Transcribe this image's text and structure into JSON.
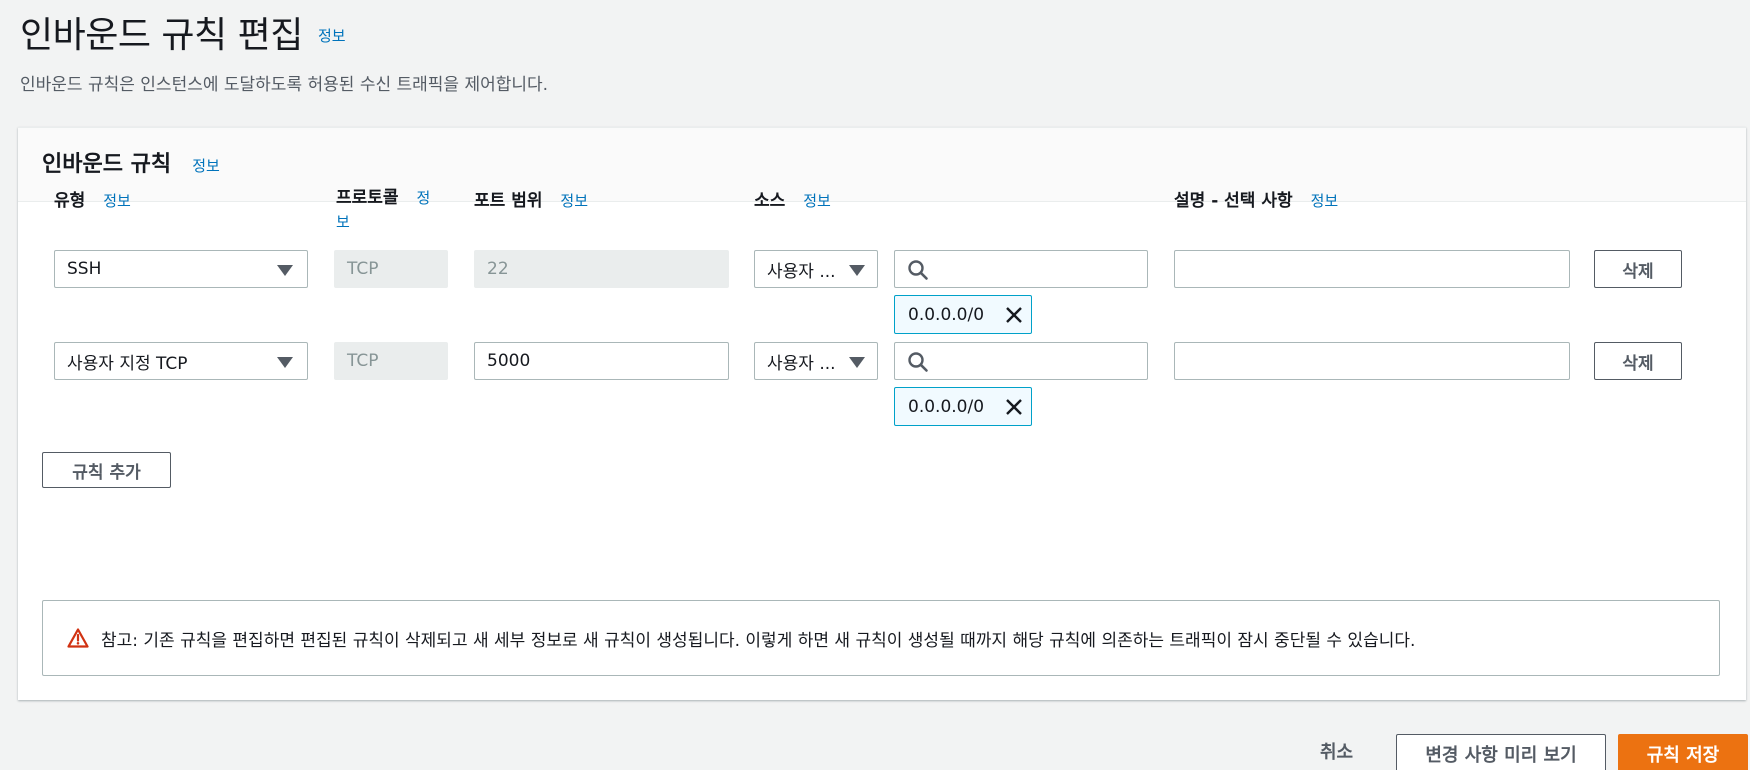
{
  "page": {
    "title": "인바운드 규칙 편집",
    "info": "정보",
    "description": "인바운드 규칙은 인스턴스에 도달하도록 허용된 수신 트래픽을 제어합니다."
  },
  "panel": {
    "title": "인바운드 규칙",
    "info": "정보",
    "columns": {
      "type": "유형",
      "protocol": "프로토콜",
      "port_range": "포트 범위",
      "source": "소스",
      "description": "설명 - 선택 사항",
      "info": "정보",
      "protocol_info_a": "정",
      "protocol_info_b": "보"
    },
    "rows": [
      {
        "type": "SSH",
        "protocol": "TCP",
        "port": "22",
        "source_type": "사용자 ...",
        "search_value": "",
        "cidr": "0.0.0.0/0",
        "description": "",
        "delete_label": "삭제"
      },
      {
        "type": "사용자 지정 TCP",
        "protocol": "TCP",
        "port": "5000",
        "source_type": "사용자 ...",
        "search_value": "",
        "cidr": "0.0.0.0/0",
        "description": "",
        "delete_label": "삭제"
      }
    ],
    "add_rule_label": "규칙 추가",
    "alert_text": "참고: 기존 규칙을 편집하면 편집된 규칙이 삭제되고 새 세부 정보로 새 규칙이 생성됩니다. 이렇게 하면 새 규칙이 생성될 때까지 해당 규칙에 의존하는 트래픽이 잠시 중단될 수 있습니다."
  },
  "footer": {
    "cancel_label": "취소",
    "preview_label": "변경 사항 미리 보기",
    "save_label": "규칙 저장"
  },
  "colors": {
    "accent": "#0073bb",
    "primary_button": "#ec7211",
    "token_border": "#00a1c9",
    "warning": "#d13212"
  },
  "icons": [
    "caret-down-icon",
    "search-icon",
    "close-icon",
    "warning-icon"
  ]
}
